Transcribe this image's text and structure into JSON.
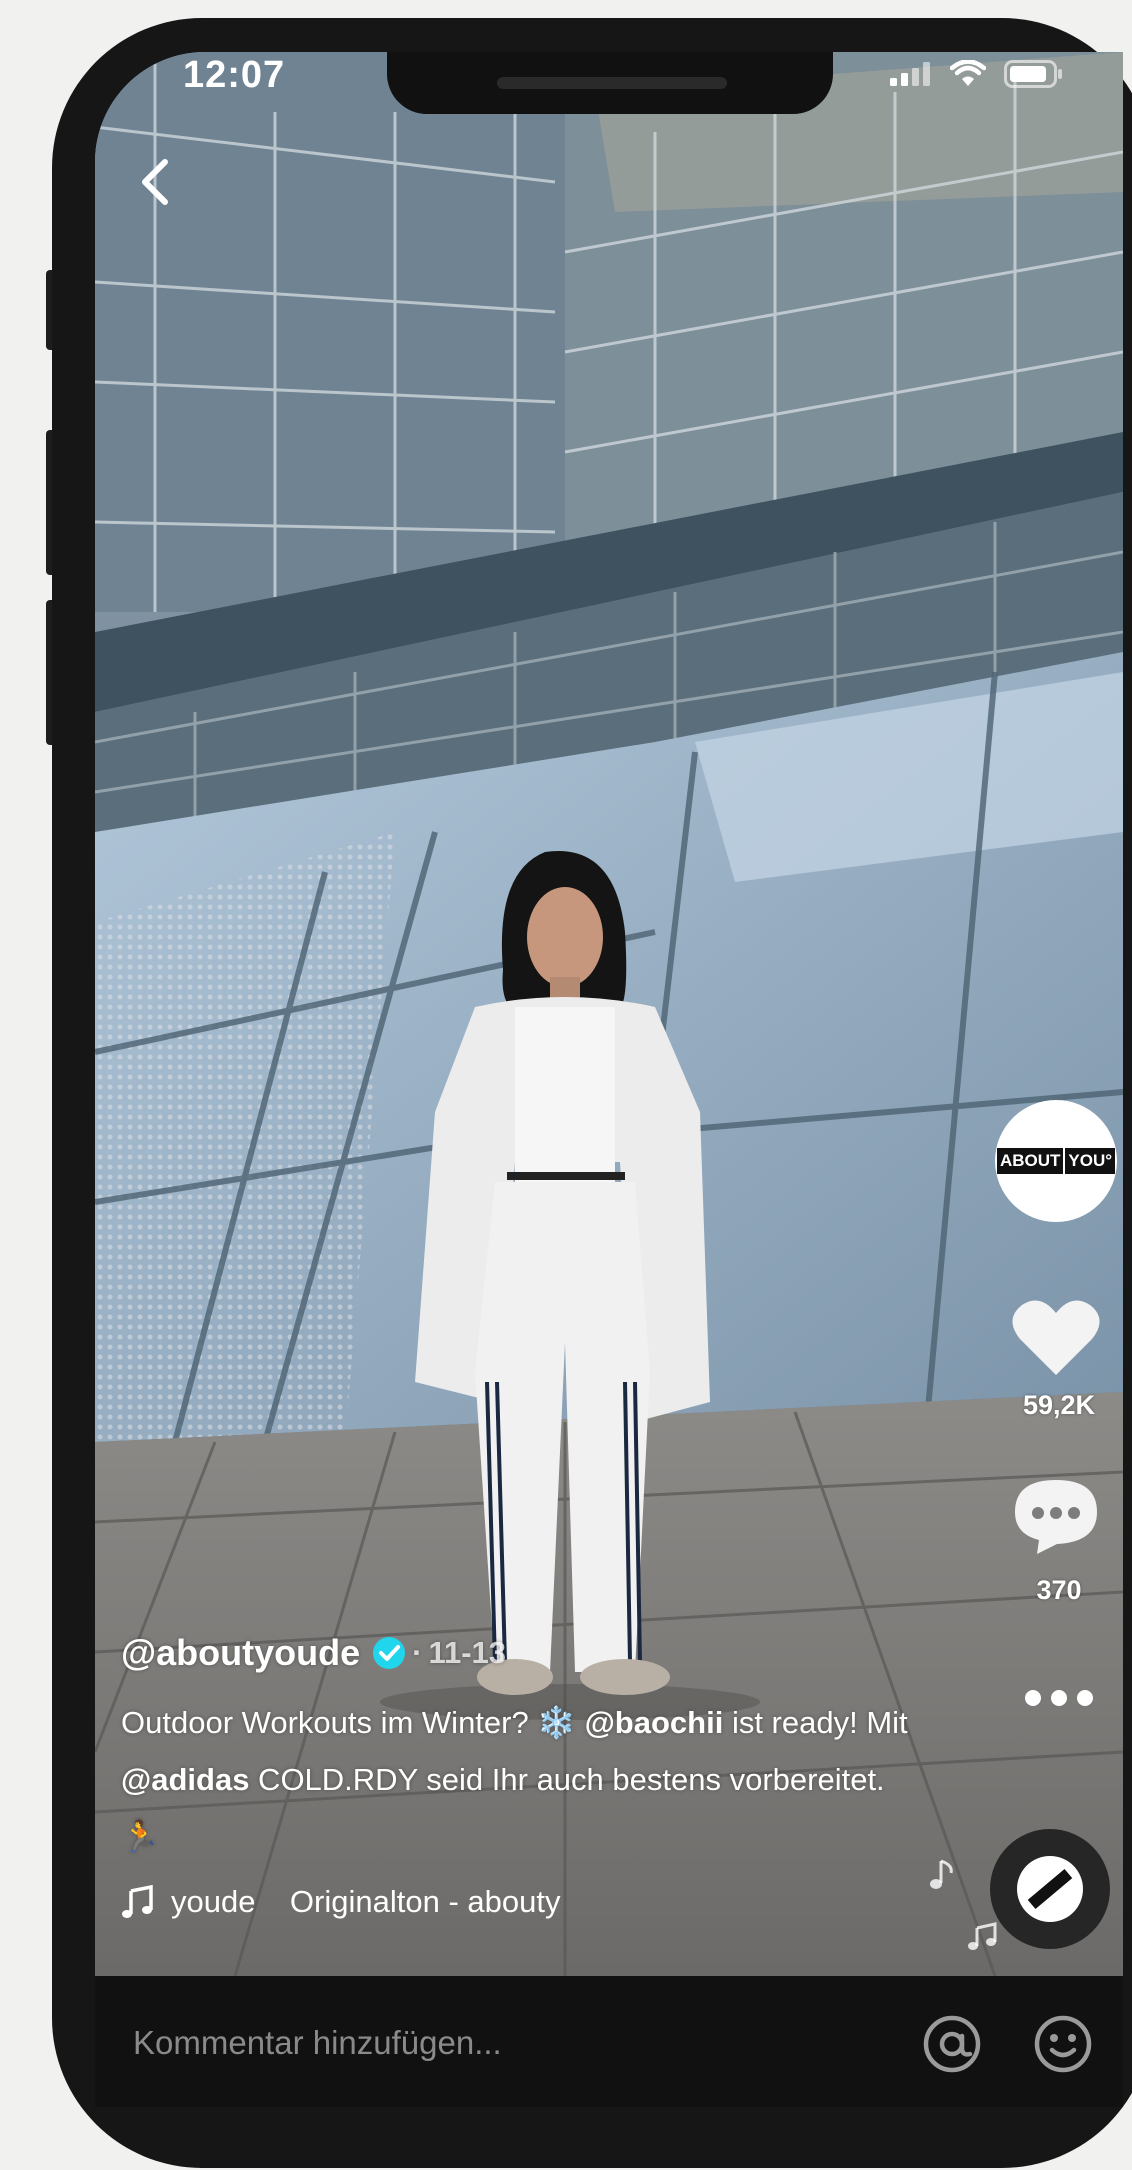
{
  "status_bar": {
    "time": "12:07"
  },
  "post": {
    "username": "@aboutyoude",
    "date_sep": "·",
    "date": "11-13",
    "caption": {
      "part1": "Outdoor Workouts im Winter? ",
      "emoji_snow": "❄️",
      "mention1": "@baochii",
      "part2": "  ist ready! Mit ",
      "mention2": "@adidas",
      "part3": "  COLD.RDY seid Ihr auch bestens vorbereitet. ",
      "emoji_run": "🏃"
    },
    "music_text": "youde    Originalton - abouty"
  },
  "profile": {
    "logo_text_left": "ABOUT",
    "logo_text_right": "YOU°"
  },
  "actions": {
    "likes": "59,2K",
    "comments": "370"
  },
  "comment_bar": {
    "placeholder": "Kommentar hinzufügen..."
  },
  "colors": {
    "verified": "#20d5ec",
    "background": "#f1f1ef",
    "phone": "#161616"
  }
}
